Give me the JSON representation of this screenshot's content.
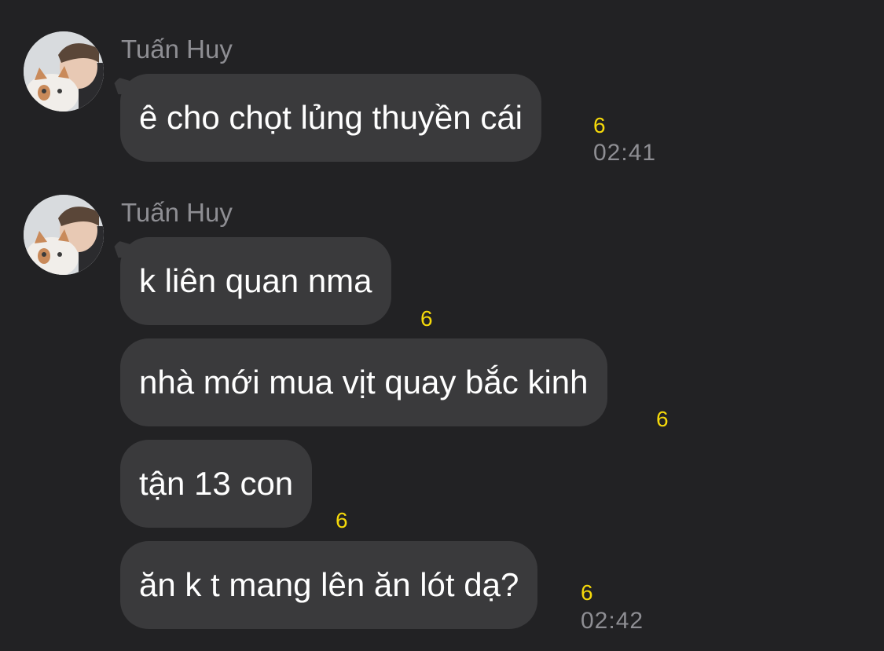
{
  "messages": [
    {
      "sender": "Tuấn Huy",
      "text": "ê cho chọt lủng thuyền cái",
      "count": "6",
      "time": "02:41"
    },
    {
      "sender": "Tuấn Huy",
      "text": "k liên quan nma",
      "count": "6"
    },
    {
      "text": "nhà mới mua vịt quay bắc kinh",
      "count": "6"
    },
    {
      "text": "tận 13 con",
      "count": "6"
    },
    {
      "text": "ăn k t mang lên ăn lót dạ?",
      "count": "6",
      "time": "02:42"
    }
  ]
}
